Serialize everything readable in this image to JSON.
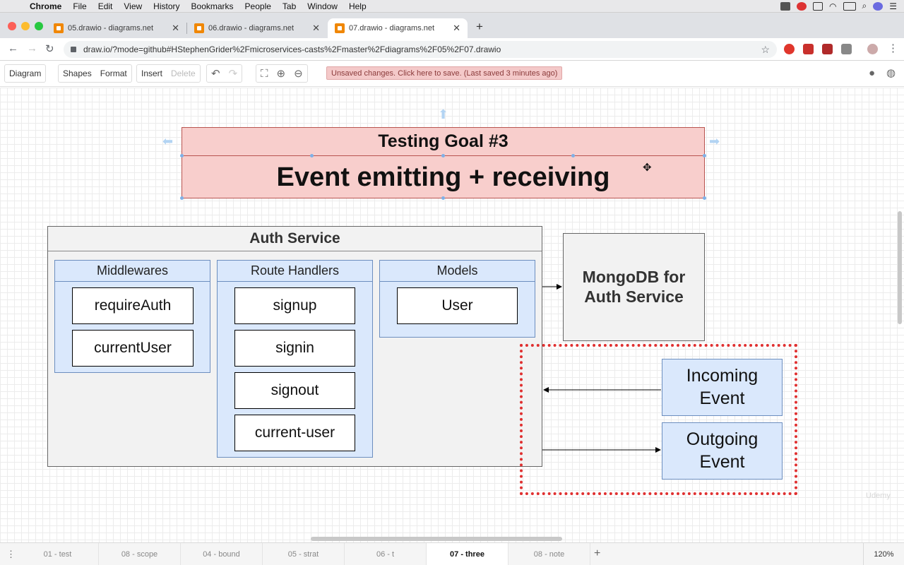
{
  "menubar": {
    "app": "Chrome",
    "items": [
      "File",
      "Edit",
      "View",
      "History",
      "Bookmarks",
      "People",
      "Tab",
      "Window",
      "Help"
    ]
  },
  "tabs": [
    {
      "title": "05.drawio - diagrams.net"
    },
    {
      "title": "06.drawio - diagrams.net"
    },
    {
      "title": "07.drawio - diagrams.net"
    }
  ],
  "address": {
    "url": "draw.io/?mode=github#HStephenGrider%2Fmicroservices-casts%2Fmaster%2Fdiagrams%2F05%2F07.drawio"
  },
  "toolbar": {
    "diagram": "Diagram",
    "shapes": "Shapes",
    "format": "Format",
    "insert": "Insert",
    "delete": "Delete",
    "unsaved": "Unsaved changes. Click here to save. (Last saved 3 minutes ago)"
  },
  "diagram": {
    "goal_title": "Testing Goal #3",
    "goal_body": "Event emitting + receiving",
    "auth_service": "Auth Service",
    "groups": [
      {
        "title": "Middlewares",
        "items": [
          "requireAuth",
          "currentUser"
        ]
      },
      {
        "title": "Route Handlers",
        "items": [
          "signup",
          "signin",
          "signout",
          "current-user"
        ]
      },
      {
        "title": "Models",
        "items": [
          "User"
        ]
      }
    ],
    "mongo": "MongoDB for Auth Service",
    "incoming": "Incoming Event",
    "outgoing": "Outgoing Event",
    "watermark": "Udemy"
  },
  "pages": [
    "01 - test",
    "08 - scope",
    "04 - bound",
    "05 - strat",
    "06 - t",
    "07 - three",
    "08 - note"
  ],
  "active_page": "07 - three",
  "zoom": "120%",
  "colors": {
    "goal_fill": "#f8cecc",
    "goal_stroke": "#b85450",
    "group_fill": "#dae8fc",
    "group_stroke": "#6c8ebf",
    "dotted_border": "#e03030",
    "unsaved_bg": "#f4c9c9"
  }
}
